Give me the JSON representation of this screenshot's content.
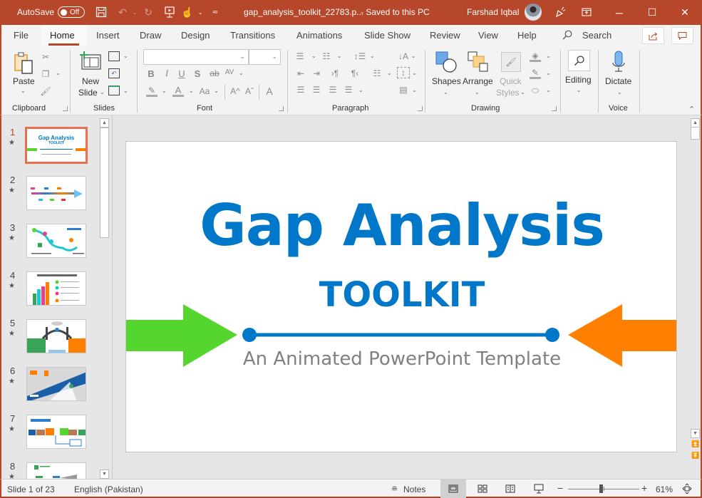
{
  "titlebar": {
    "autosave_label": "AutoSave",
    "autosave_state": "Off",
    "filename": "gap_analysis_toolkit_22783.p...",
    "save_status": "-  Saved to this PC",
    "user_name": "Farshad Iqbal",
    "icons": [
      "save-icon",
      "undo-icon",
      "redo-icon",
      "present-icon",
      "touch-mode-icon",
      "customize-qat-icon"
    ],
    "window_buttons": {
      "minimize": "─",
      "maximize": "☐",
      "close": "✕"
    }
  },
  "menu": {
    "tabs": [
      "File",
      "Home",
      "Insert",
      "Draw",
      "Design",
      "Transitions",
      "Animations",
      "Slide Show",
      "Review",
      "View",
      "Help"
    ],
    "active_tab": "Home",
    "search_label": "Search"
  },
  "ribbon": {
    "groups": {
      "clipboard": {
        "label": "Clipboard",
        "paste": "Paste"
      },
      "slides": {
        "label": "Slides",
        "new_slide_line1": "New",
        "new_slide_line2": "Slide"
      },
      "font": {
        "label": "Font",
        "font_name": "",
        "font_size": "",
        "buttons": [
          "B",
          "I",
          "U",
          "S",
          "ab",
          "AV",
          "Aa",
          "A^",
          "Aˇ"
        ]
      },
      "paragraph": {
        "label": "Paragraph"
      },
      "drawing": {
        "label": "Drawing",
        "shapes": "Shapes",
        "arrange": "Arrange",
        "quick_styles_1": "Quick",
        "quick_styles_2": "Styles"
      },
      "editing": {
        "label": "Editing"
      },
      "voice": {
        "label": "Voice",
        "dictate": "Dictate"
      }
    }
  },
  "slides_panel": {
    "slides": [
      {
        "num": "1",
        "active": true
      },
      {
        "num": "2"
      },
      {
        "num": "3"
      },
      {
        "num": "4"
      },
      {
        "num": "5"
      },
      {
        "num": "6"
      },
      {
        "num": "7"
      },
      {
        "num": "8"
      }
    ],
    "thumb1_title": "Gap Analysis",
    "thumb1_sub": "TOOLKIT"
  },
  "slide": {
    "title": "Gap Analysis",
    "subtitle": "TOOLKIT",
    "tagline": "An Animated PowerPoint Template",
    "colors": {
      "title": "#0077c8",
      "left_arrow": "#55d62e",
      "right_arrow": "#ff8000",
      "tagline": "#808080"
    }
  },
  "statusbar": {
    "slide_indicator": "Slide 1 of 23",
    "language": "English (Pakistan)",
    "notes_label": "Notes",
    "zoom_level": "61%",
    "zoom_fraction": 0.46
  },
  "theme": {
    "accent": "#b7472a"
  }
}
